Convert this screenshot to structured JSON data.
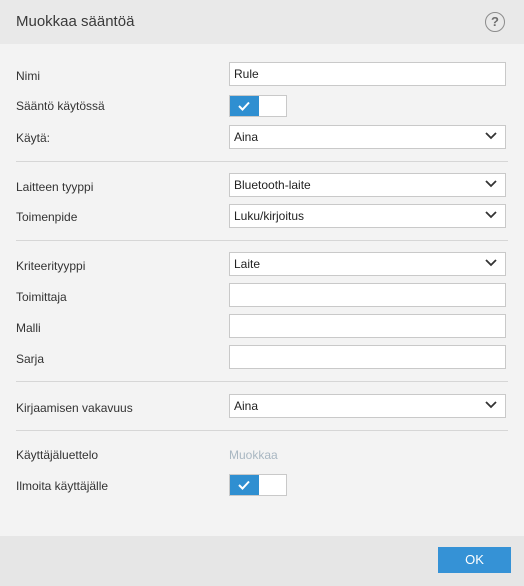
{
  "dialog": {
    "title": "Muokkaa sääntöä",
    "help_symbol": "?"
  },
  "form": {
    "name": {
      "label": "Nimi",
      "value": "Rule"
    },
    "rule_enabled": {
      "label": "Sääntö käytössä",
      "enabled": true
    },
    "apply": {
      "label": "Käytä:",
      "value": "Aina"
    },
    "device_type": {
      "label": "Laitteen tyyppi",
      "value": "Bluetooth-laite"
    },
    "action": {
      "label": "Toimenpide",
      "value": "Luku/kirjoitus"
    },
    "criteria_type": {
      "label": "Kriteerityyppi",
      "value": "Laite"
    },
    "vendor": {
      "label": "Toimittaja",
      "value": ""
    },
    "model": {
      "label": "Malli",
      "value": ""
    },
    "serial": {
      "label": "Sarja",
      "value": ""
    },
    "log_severity": {
      "label": "Kirjaamisen vakavuus",
      "value": "Aina"
    },
    "user_list": {
      "label": "Käyttäjäluettelo",
      "link": "Muokkaa"
    },
    "notify_user": {
      "label": "Ilmoita käyttäjälle",
      "enabled": true
    }
  },
  "footer": {
    "ok_label": "OK"
  },
  "colors": {
    "accent": "#2f8fd1",
    "ok_button": "#3592d6",
    "disabled_link": "#a9b7c2"
  },
  "icons": {
    "help": "help-icon",
    "toggle_check": "check-icon",
    "dropdown": "chevron-down-icon"
  }
}
